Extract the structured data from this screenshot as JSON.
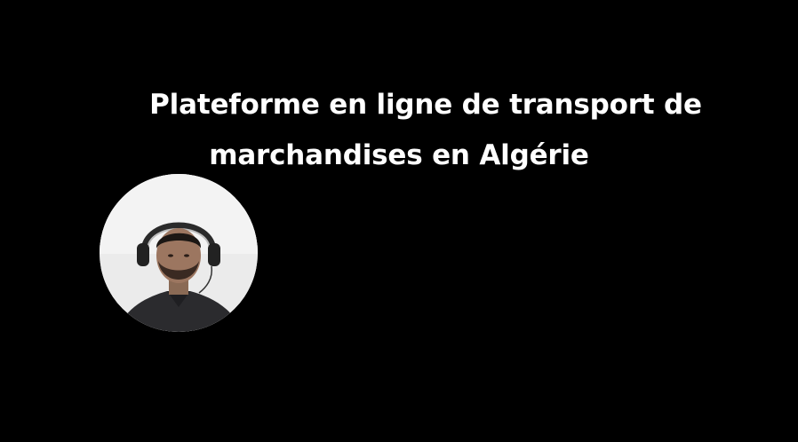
{
  "slide": {
    "title_line1": "Plateforme en ligne de transport de",
    "title_line2": "marchandises en Algérie"
  },
  "webcam": {
    "icon": "presenter-webcam-bubble"
  },
  "colors": {
    "background": "#000000",
    "title_text": "#ffffff"
  }
}
